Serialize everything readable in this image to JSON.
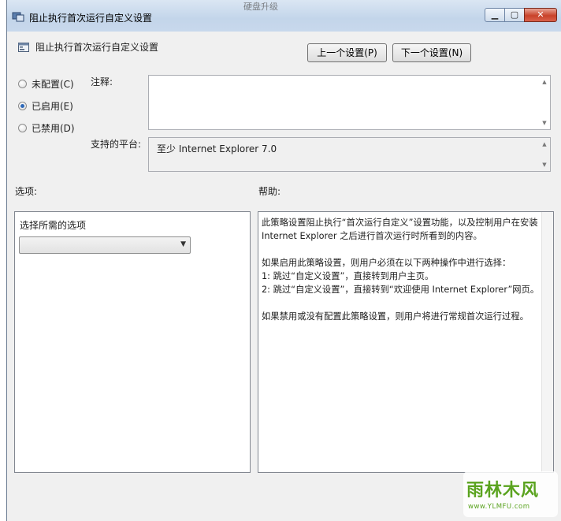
{
  "window": {
    "title": "阻止执行首次运行自定义设置",
    "background_title": "硬盘升级",
    "controls": {
      "minimize": "▁",
      "maximize": "▢",
      "close": "✕"
    }
  },
  "header": {
    "title": "阻止执行首次运行自定义设置",
    "prev_button": "上一个设置(P)",
    "next_button": "下一个设置(N)"
  },
  "state": {
    "options": [
      {
        "label": "未配置(C)",
        "selected": false
      },
      {
        "label": "已启用(E)",
        "selected": true
      },
      {
        "label": "已禁用(D)",
        "selected": false
      }
    ]
  },
  "comment": {
    "label": "注释:",
    "value": ""
  },
  "platform": {
    "label": "支持的平台:",
    "value": "至少 Internet Explorer 7.0"
  },
  "options_section": {
    "label": "选项:",
    "prompt": "选择所需的选项",
    "dropdown_value": ""
  },
  "help_section": {
    "label": "帮助:",
    "text": "此策略设置阻止执行“首次运行自定义”设置功能，以及控制用户在安装 Internet Explorer 之后进行首次运行时所看到的内容。\n\n如果启用此策略设置，则用户必须在以下两种操作中进行选择：\n1: 跳过“自定义设置”，直接转到用户主页。\n2: 跳过“自定义设置”，直接转到“欢迎使用 Internet Explorer”网页。\n\n如果禁用或没有配置此策略设置，则用户将进行常规首次运行过程。"
  },
  "watermark": {
    "logo": "雨林木风",
    "url": "www.YLMFU.com"
  },
  "icons": [
    "policy-icon",
    "setting-icon",
    "chevron-down-icon",
    "scroll-up-icon",
    "scroll-down-icon"
  ],
  "colors": {
    "accent": "#2e69b8",
    "watermark": "#5aa31f",
    "titlebar": "#c3d5ea"
  }
}
